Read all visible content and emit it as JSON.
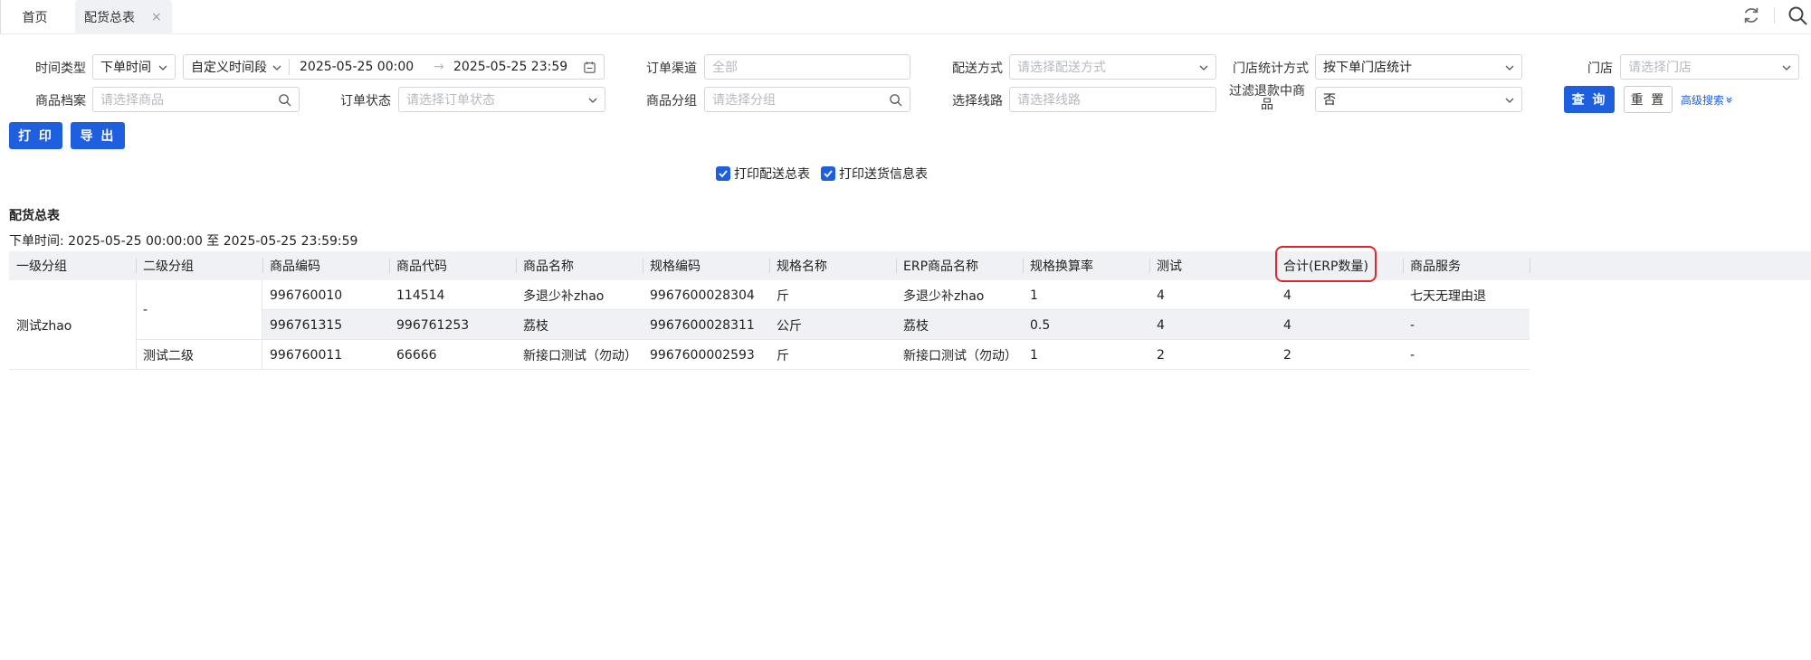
{
  "tabs": {
    "home": "首页",
    "active": "配货总表",
    "close": "×"
  },
  "filters": {
    "time_type_label": "时间类型",
    "time_type_value": "下单时间",
    "period_value": "自定义时间段",
    "date_start": "2025-05-25 00:00",
    "date_arrow": "→",
    "date_end": "2025-05-25 23:59",
    "channel_label": "订单渠道",
    "channel_placeholder": "全部",
    "delivery_label": "配送方式",
    "delivery_placeholder": "请选择配送方式",
    "store_stat_label": "门店统计方式",
    "store_stat_value": "按下单门店统计",
    "store_label": "门店",
    "store_placeholder": "请选择门店",
    "product_label": "商品档案",
    "product_placeholder": "请选择商品",
    "order_status_label": "订单状态",
    "order_status_placeholder": "请选择订单状态",
    "group_label": "商品分组",
    "group_placeholder": "请选择分组",
    "route_label": "选择线路",
    "route_placeholder": "请选择线路",
    "refund_label_line1": "过滤退款中商",
    "refund_label_line2": "品",
    "refund_value": "否",
    "query_button": "查 询",
    "reset_button": "重 置",
    "advanced_search": "高级搜索"
  },
  "actions": {
    "print_button": "打 印",
    "export_button": "导 出"
  },
  "options": {
    "print_summary": "打印配送总表",
    "print_delivery_info": "打印送货信息表"
  },
  "report": {
    "title": "配货总表",
    "time_range": "下单时间: 2025-05-25 00:00:00 至 2025-05-25 23:59:59"
  },
  "table": {
    "headers": [
      "一级分组",
      "二级分组",
      "商品编码",
      "商品代码",
      "商品名称",
      "规格编码",
      "规格名称",
      "ERP商品名称",
      "规格换算率",
      "测试",
      "合计(ERP数量)",
      "商品服务"
    ],
    "group1": "测试zhao",
    "group2_a": "-",
    "group2_b": "测试二级",
    "rows": [
      [
        "996760010",
        "114514",
        "多退少补zhao",
        "9967600028304",
        "斤",
        "多退少补zhao",
        "1",
        "4",
        "4",
        "七天无理由退"
      ],
      [
        "996761315",
        "996761253",
        "荔枝",
        "9967600028311",
        "公斤",
        "荔枝",
        "0.5",
        "4",
        "4",
        "-"
      ],
      [
        "996760011",
        "66666",
        "新接口测试（勿动）",
        "9967600002593",
        "斤",
        "新接口测试（勿动）",
        "1",
        "2",
        "2",
        "-"
      ]
    ]
  },
  "colors": {
    "primary": "#1e5fe0",
    "highlight": "#e0262b",
    "header_bg": "#f0f1f4"
  }
}
